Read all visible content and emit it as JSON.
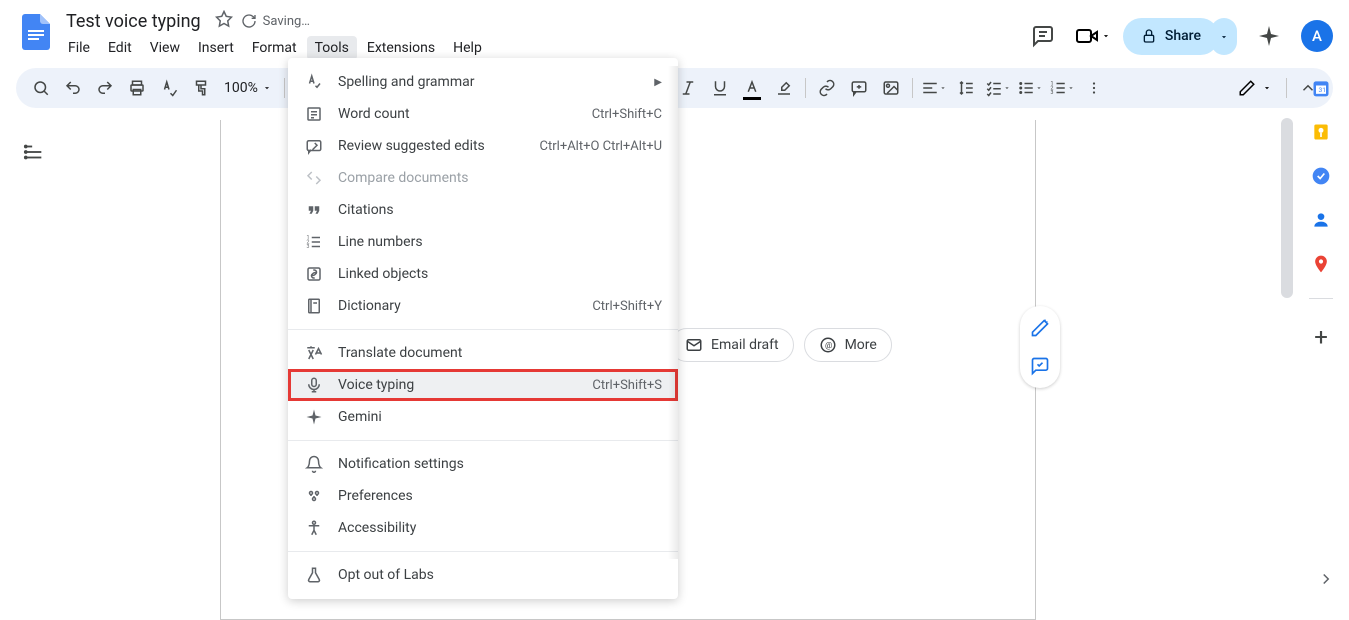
{
  "doc": {
    "title": "Test voice typing",
    "saving_status": "Saving…"
  },
  "menubar": {
    "file": "File",
    "edit": "Edit",
    "view": "View",
    "insert": "Insert",
    "format": "Format",
    "tools": "Tools",
    "extensions": "Extensions",
    "help": "Help"
  },
  "toolbar": {
    "zoom": "100%"
  },
  "share": {
    "label": "Share"
  },
  "avatar": {
    "initial": "A"
  },
  "tools_menu": {
    "spelling": "Spelling and grammar",
    "word_count": {
      "label": "Word count",
      "shortcut": "Ctrl+Shift+C"
    },
    "review_edits": {
      "label": "Review suggested edits",
      "shortcut": "Ctrl+Alt+O Ctrl+Alt+U"
    },
    "compare": "Compare documents",
    "citations": "Citations",
    "line_numbers": "Line numbers",
    "linked_objects": "Linked objects",
    "dictionary": {
      "label": "Dictionary",
      "shortcut": "Ctrl+Shift+Y"
    },
    "translate": "Translate document",
    "voice_typing": {
      "label": "Voice typing",
      "shortcut": "Ctrl+Shift+S"
    },
    "gemini": "Gemini",
    "notification": "Notification settings",
    "preferences": "Preferences",
    "accessibility": "Accessibility",
    "opt_out_labs": "Opt out of Labs"
  },
  "chips": {
    "email_draft": "Email draft",
    "more": "More"
  }
}
